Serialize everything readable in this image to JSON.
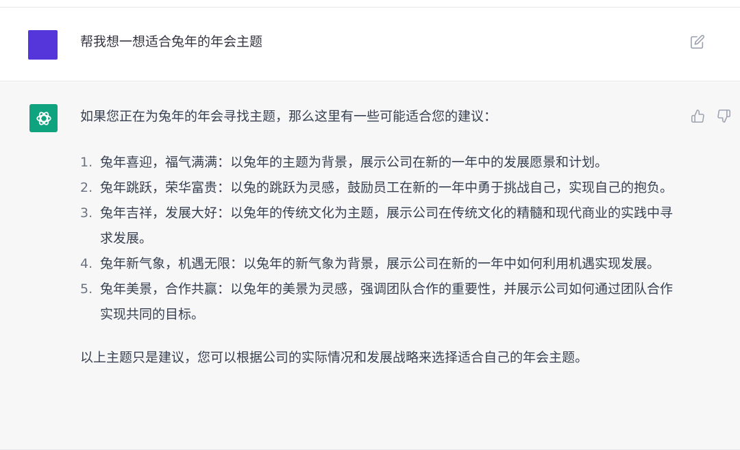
{
  "user_message": {
    "text": "帮我想一想适合兔年的年会主题",
    "avatar_color": "#5436da",
    "edit_icon": "edit-icon"
  },
  "assistant_message": {
    "avatar_color": "#10a37f",
    "avatar_icon": "openai-logo-icon",
    "intro": "如果您正在为兔年的年会寻找主题，那么这里有一些可能适合您的建议：",
    "items": [
      {
        "num": "1.",
        "text": "兔年喜迎，福气满满：以兔年的主题为背景，展示公司在新的一年中的发展愿景和计划。"
      },
      {
        "num": "2.",
        "text": "兔年跳跃，荣华富贵：以兔的跳跃为灵感，鼓励员工在新的一年中勇于挑战自己，实现自己的抱负。"
      },
      {
        "num": "3.",
        "text": "兔年吉祥，发展大好：以兔年的传统文化为主题，展示公司在传统文化的精髓和现代商业的实践中寻求发展。"
      },
      {
        "num": "4.",
        "text": "兔年新气象，机遇无限：以兔年的新气象为背景，展示公司在新的一年中如何利用机遇实现发展。"
      },
      {
        "num": "5.",
        "text": "兔年美景，合作共赢：以兔年的美景为灵感，强调团队合作的重要性，并展示公司如何通过团队合作实现共同的目标。"
      }
    ],
    "outro": "以上主题只是建议，您可以根据公司的实际情况和发展战略来选择适合自己的年会主题。",
    "feedback_icons": [
      "thumbs-up-icon",
      "thumbs-down-icon"
    ]
  }
}
